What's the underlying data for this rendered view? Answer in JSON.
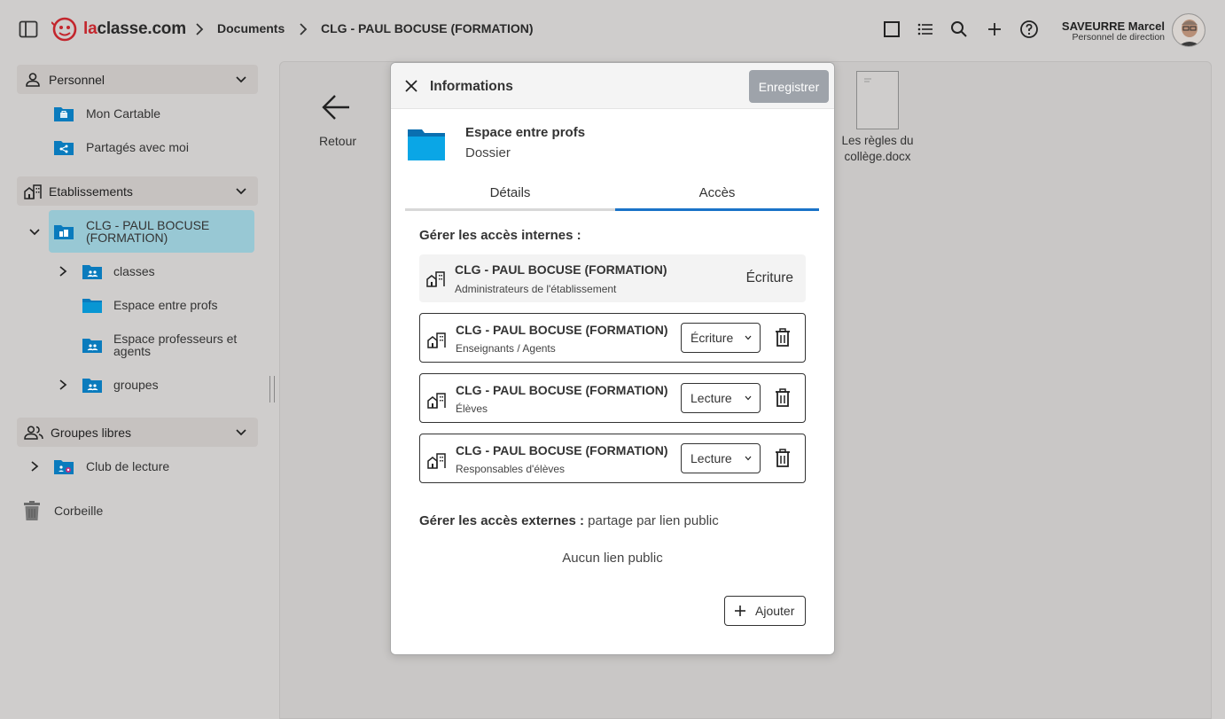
{
  "header": {
    "logo_text_red": "la",
    "logo_text": "classe.com",
    "breadcrumbs": [
      "Documents",
      "CLG - PAUL BOCUSE (FORMATION)"
    ],
    "user_name": "SAVEURRE Marcel",
    "user_role": "Personnel de direction",
    "icons": [
      "sidebar-toggle-icon",
      "square-view-icon",
      "list-view-icon",
      "search-icon",
      "plus-icon",
      "help-icon"
    ]
  },
  "sidebar": {
    "personnel": {
      "label": "Personnel",
      "items": [
        "Mon Cartable",
        "Partagés avec moi"
      ]
    },
    "etablissements": {
      "label": "Etablissements",
      "school": "CLG - PAUL BOCUSE (FORMATION)",
      "items": [
        "classes",
        "Espace entre profs",
        "Espace professeurs et agents",
        "groupes"
      ]
    },
    "groupes_libres": {
      "label": "Groupes libres",
      "items": [
        "Club de lecture"
      ]
    },
    "trash": "Corbeille"
  },
  "main": {
    "back_label": "Retour",
    "document_name": "Les règles du collège.docx"
  },
  "modal": {
    "title": "Informations",
    "save_label": "Enregistrer",
    "item_name": "Espace entre profs",
    "item_type": "Dossier",
    "tabs": [
      "Détails",
      "Accès"
    ],
    "active_tab": "Accès",
    "internal_title": "Gérer les accès internes :",
    "fixed_access": {
      "name": "CLG - PAUL BOCUSE (FORMATION)",
      "sub": "Administrateurs de l'établissement",
      "right": "Écriture"
    },
    "access_rows": [
      {
        "name": "CLG - PAUL BOCUSE (FORMATION)",
        "sub": "Enseignants / Agents",
        "right": "Écriture"
      },
      {
        "name": "CLG - PAUL BOCUSE (FORMATION)",
        "sub": "Élèves",
        "right": "Lecture"
      },
      {
        "name": "CLG - PAUL BOCUSE (FORMATION)",
        "sub": "Responsables d'élèves",
        "right": "Lecture"
      }
    ],
    "external_title": "Gérer les accès externes :",
    "external_sub": "partage par lien public",
    "no_link": "Aucun lien public",
    "add_label": "Ajouter"
  },
  "colors": {
    "brand_red": "#c3262d",
    "folder_blue": "#0a7bbd",
    "tab_active": "#1a73c8",
    "active_item": "#98c8d4"
  }
}
